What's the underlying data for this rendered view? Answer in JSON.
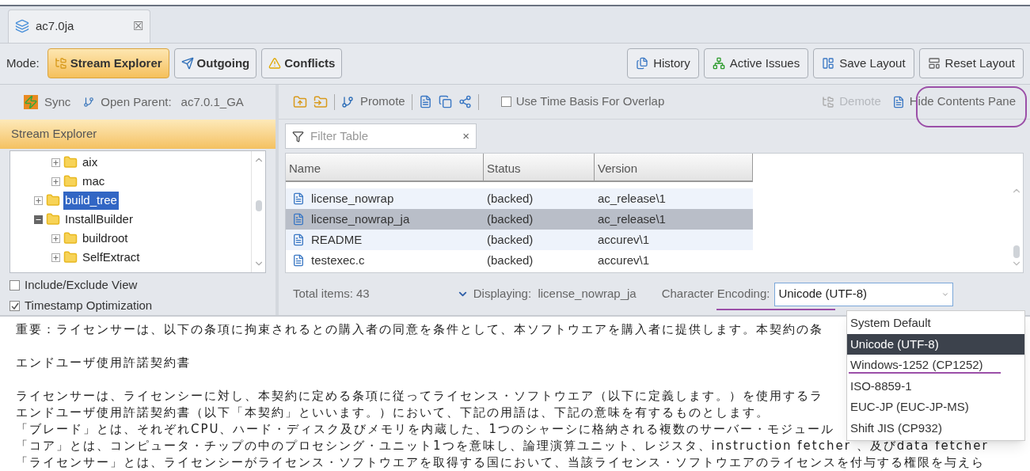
{
  "tab": {
    "label": "ac7.0ja",
    "close": "☒"
  },
  "mode_bar": {
    "label": "Mode:",
    "modes": [
      {
        "label": "Stream Explorer",
        "kind": "explorer",
        "selected": true
      },
      {
        "label": "Outgoing",
        "kind": "outgoing",
        "selected": false
      },
      {
        "label": "Conflicts",
        "kind": "conflicts",
        "selected": false
      }
    ],
    "actions": [
      {
        "label": "History",
        "kind": "history"
      },
      {
        "label": "Active Issues",
        "kind": "issues"
      },
      {
        "label": "Save Layout",
        "kind": "save"
      },
      {
        "label": "Reset Layout",
        "kind": "reset"
      }
    ]
  },
  "left_toolbar": {
    "sync": "Sync",
    "open_parent": "Open Parent:",
    "parent": "ac7.0.1_GA"
  },
  "stream_explorer": {
    "title": "Stream Explorer",
    "tree": [
      {
        "children": [
          {
            "label": "aix",
            "expanded": false,
            "selected": false
          },
          {
            "label": "mac",
            "expanded": false,
            "selected": false
          }
        ]
      },
      {
        "label": "build_tree",
        "expanded": false,
        "selected": true
      },
      {
        "label": "InstallBuilder",
        "expanded": true,
        "selected": false,
        "children": [
          {
            "label": "buildroot",
            "expanded": false,
            "selected": false
          },
          {
            "label": "SelfExtract",
            "expanded": false,
            "selected": false
          }
        ]
      }
    ]
  },
  "options": [
    {
      "label": "Include/Exclude View",
      "checked": false
    },
    {
      "label": "Timestamp Optimization",
      "checked": true
    }
  ],
  "right_toolbar": {
    "promote": "Promote",
    "time_basis": {
      "label": "Use Time Basis For Overlap",
      "checked": false
    },
    "demote": {
      "label": "Demote",
      "disabled": true
    },
    "hide": "Hide Contents Pane"
  },
  "filter": {
    "placeholder": "Filter Table",
    "clear": "×"
  },
  "table": {
    "columns": [
      "Name",
      "Status",
      "Version"
    ],
    "rows": [
      {
        "name": "license_nowrap",
        "status": "(backed)",
        "version": "ac_release\\1",
        "selected": false
      },
      {
        "name": "license_nowrap_ja",
        "status": "(backed)",
        "version": "ac_release\\1",
        "selected": true
      },
      {
        "name": "README",
        "status": "(backed)",
        "version": "accurev\\1",
        "selected": false
      },
      {
        "name": "testexec.c",
        "status": "(backed)",
        "version": "accurev\\1",
        "selected": false
      }
    ]
  },
  "footer": {
    "total": "Total items: 43",
    "displaying": "Displaying:  license_nowrap_ja",
    "encoding_label": "Character Encoding:"
  },
  "encoding": {
    "value": "Unicode (UTF-8)",
    "expanded": true,
    "options": [
      {
        "label": "System Default",
        "selected": false
      },
      {
        "label": "Unicode (UTF-8)",
        "selected": true
      },
      {
        "label": "Windows-1252 (CP1252)",
        "selected": false
      },
      {
        "label": "ISO-8859-1",
        "selected": false
      },
      {
        "label": "EUC-JP (EUC-JP-MS)",
        "selected": false
      },
      {
        "label": "Shift JIS (CP932)",
        "selected": false
      }
    ]
  },
  "contents": [
    [
      "重要：ライセンサーは、以下の条項に拘束されるとの購入者の同意を条件として、本ソフトウエアを購入者に提供します。本契約の条"
    ],
    [
      "エンドユーザ使用許諾契約書"
    ],
    [
      "ライセンサーは、ライセンシーに対し、本契約に定める条項に従ってライセンス・ソフトウエア（以下に定義します。）を使用するラ",
      "エンドユーザ使用許諾契約書（以下「本契約」といいます。）において、下記の用語は、下記の意味を有するものとします。",
      "「ブレード」とは、それぞれCPU、ハード・ディスク及びメモリを内蔵した、1つのシャーシに格納される複数のサーバー・モジュール",
      "「コア」とは、コンピュータ・チップの中のプロセシング・ユニット1つを意味し、論理演算ユニット、レジスタ、instruction fetcher 、及びdata fetcher",
      "「ライセンサー」とは、ライセンシーがライセンス・ソフトウエアを取得する国において、当該ライセンス・ソフトウエアのライセンスを付与する権限を与えら"
    ]
  ]
}
